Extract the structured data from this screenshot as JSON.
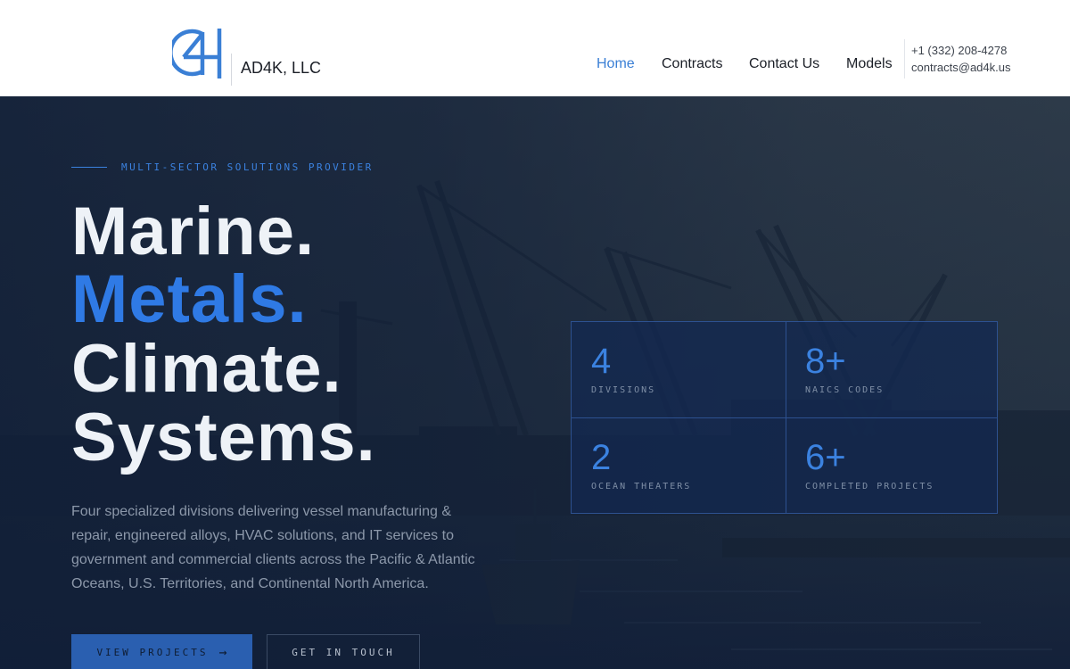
{
  "header": {
    "brand": "AD4K, LLC",
    "nav": [
      "Home",
      "Contracts",
      "Contact Us",
      "Models"
    ],
    "active_nav": "Home",
    "phone": "+1 (332) 208-4278",
    "email": "contracts@ad4k.us"
  },
  "hero": {
    "eyebrow": "MULTI-SECTOR SOLUTIONS PROVIDER",
    "headline": [
      "Marine.",
      "Metals.",
      "Climate.",
      "Systems."
    ],
    "highlighted_line": "Metals.",
    "description": "Four specialized divisions delivering vessel manufacturing & repair, engineered alloys, HVAC solutions, and IT services to government and commercial clients across the Pacific & Atlantic Oceans, U.S. Territories, and Continental North America.",
    "primary_button": "VIEW PROJECTS",
    "primary_button_icon": "arrow-right-icon",
    "secondary_button": "GET IN TOUCH"
  },
  "stats": [
    {
      "value": "4",
      "label": "DIVISIONS"
    },
    {
      "value": "8+",
      "label": "NAICS CODES"
    },
    {
      "value": "2",
      "label": "OCEAN THEATERS"
    },
    {
      "value": "6+",
      "label": "COMPLETED PROJECTS"
    }
  ],
  "colors": {
    "accent": "#2f7ae5",
    "header_bg": "#ffffff",
    "hero_bg": "#13233d",
    "headline": "#eef2f7",
    "primary_button": "#2a5fb0"
  }
}
